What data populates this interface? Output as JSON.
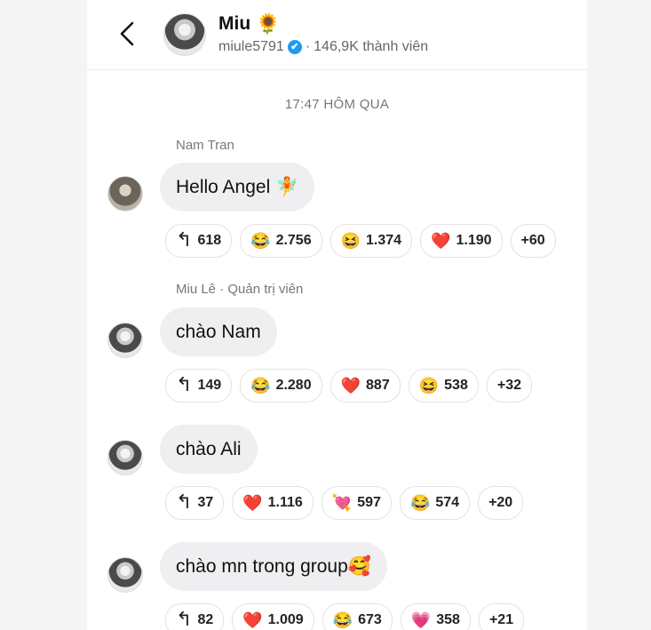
{
  "header": {
    "title": "Miu",
    "title_emoji": "🌻",
    "username": "miule5791",
    "verified_mark": "✔",
    "separator": "·",
    "members": "146,9K thành viên",
    "back_icon": "chevron-left-icon"
  },
  "timestamp": "17:47 HÔM QUA",
  "messages": [
    {
      "sender": "Nam Tran",
      "text": "Hello Angel 🧚",
      "replies": "618",
      "reactions": [
        {
          "emoji": "😂",
          "icon": "tears-of-joy-icon",
          "count": "2.756"
        },
        {
          "emoji": "😆",
          "icon": "grinning-squint-icon",
          "count": "1.374"
        },
        {
          "emoji": "❤️",
          "icon": "red-heart-icon",
          "count": "1.190"
        }
      ],
      "more": "+60"
    },
    {
      "sender": "Miu Lê · Quản trị viên",
      "text": "chào Nam",
      "replies": "149",
      "reactions": [
        {
          "emoji": "😂",
          "icon": "tears-of-joy-icon",
          "count": "2.280"
        },
        {
          "emoji": "❤️",
          "icon": "red-heart-icon",
          "count": "887"
        },
        {
          "emoji": "😆",
          "icon": "grinning-squint-icon",
          "count": "538"
        }
      ],
      "more": "+32"
    },
    {
      "sender": "",
      "text": "chào Ali",
      "replies": "37",
      "reactions": [
        {
          "emoji": "❤️",
          "icon": "red-heart-icon",
          "count": "1.116"
        },
        {
          "emoji": "💘",
          "icon": "heart-with-arrow-icon",
          "count": "597"
        },
        {
          "emoji": "😂",
          "icon": "tears-of-joy-icon",
          "count": "574"
        }
      ],
      "more": "+20"
    },
    {
      "sender": "",
      "text": "chào mn trong group🥰",
      "replies": "82",
      "reactions": [
        {
          "emoji": "❤️",
          "icon": "red-heart-icon",
          "count": "1.009"
        },
        {
          "emoji": "😂",
          "icon": "tears-of-joy-icon",
          "count": "673"
        },
        {
          "emoji": "💗",
          "icon": "growing-heart-icon",
          "count": "358"
        }
      ],
      "more": "+21"
    }
  ],
  "reply_icon_glyph": "↰",
  "colors": {
    "verified": "#1d9bf0",
    "bubble": "#efeff1",
    "meta_text": "#777777"
  }
}
